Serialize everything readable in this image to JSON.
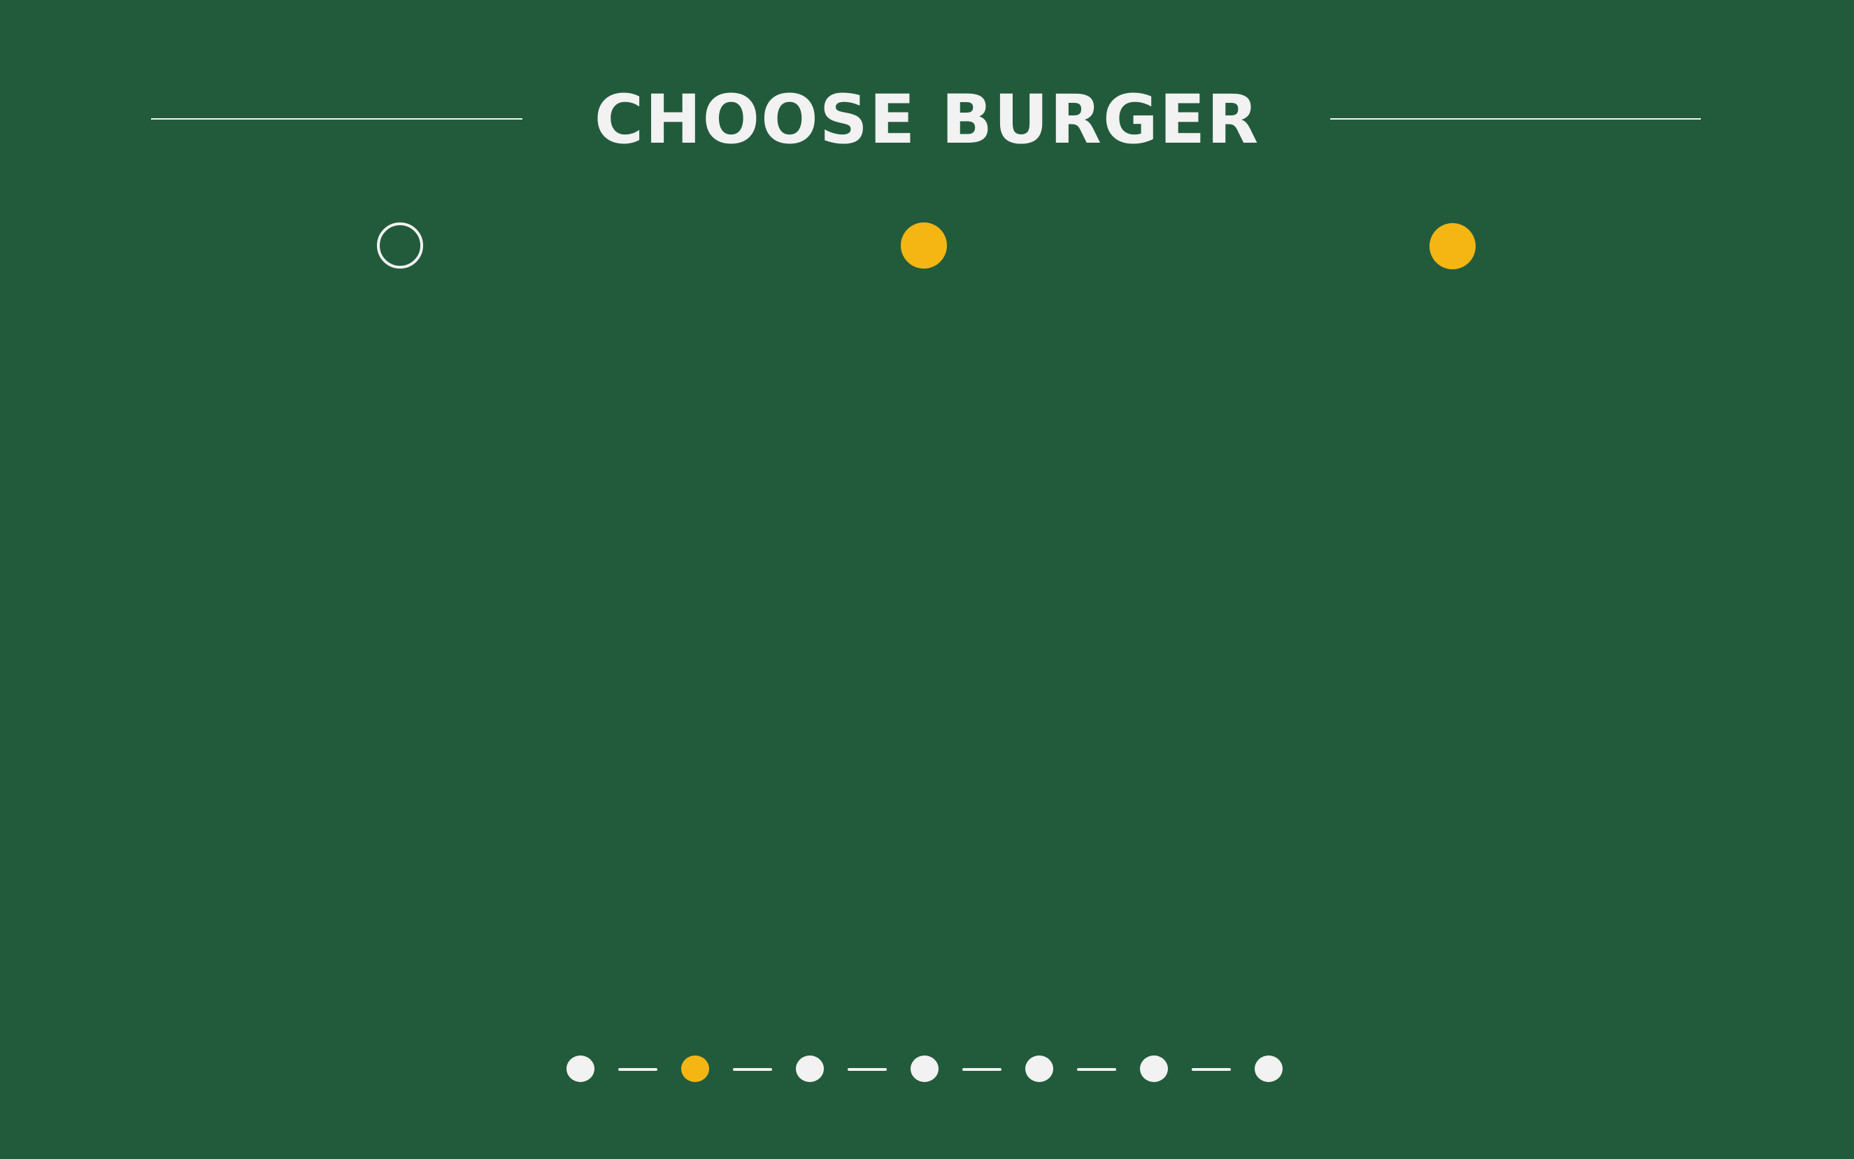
{
  "header": {
    "title": "CHOOSE BURGER"
  },
  "options": [
    {
      "state": "unselected"
    },
    {
      "state": "filled"
    },
    {
      "state": "filled"
    }
  ],
  "stepper": {
    "total_steps": 7,
    "current_step": 2
  },
  "colors": {
    "background": "#225B3C",
    "accent": "#F5B614",
    "foreground": "#F2F2F2"
  }
}
